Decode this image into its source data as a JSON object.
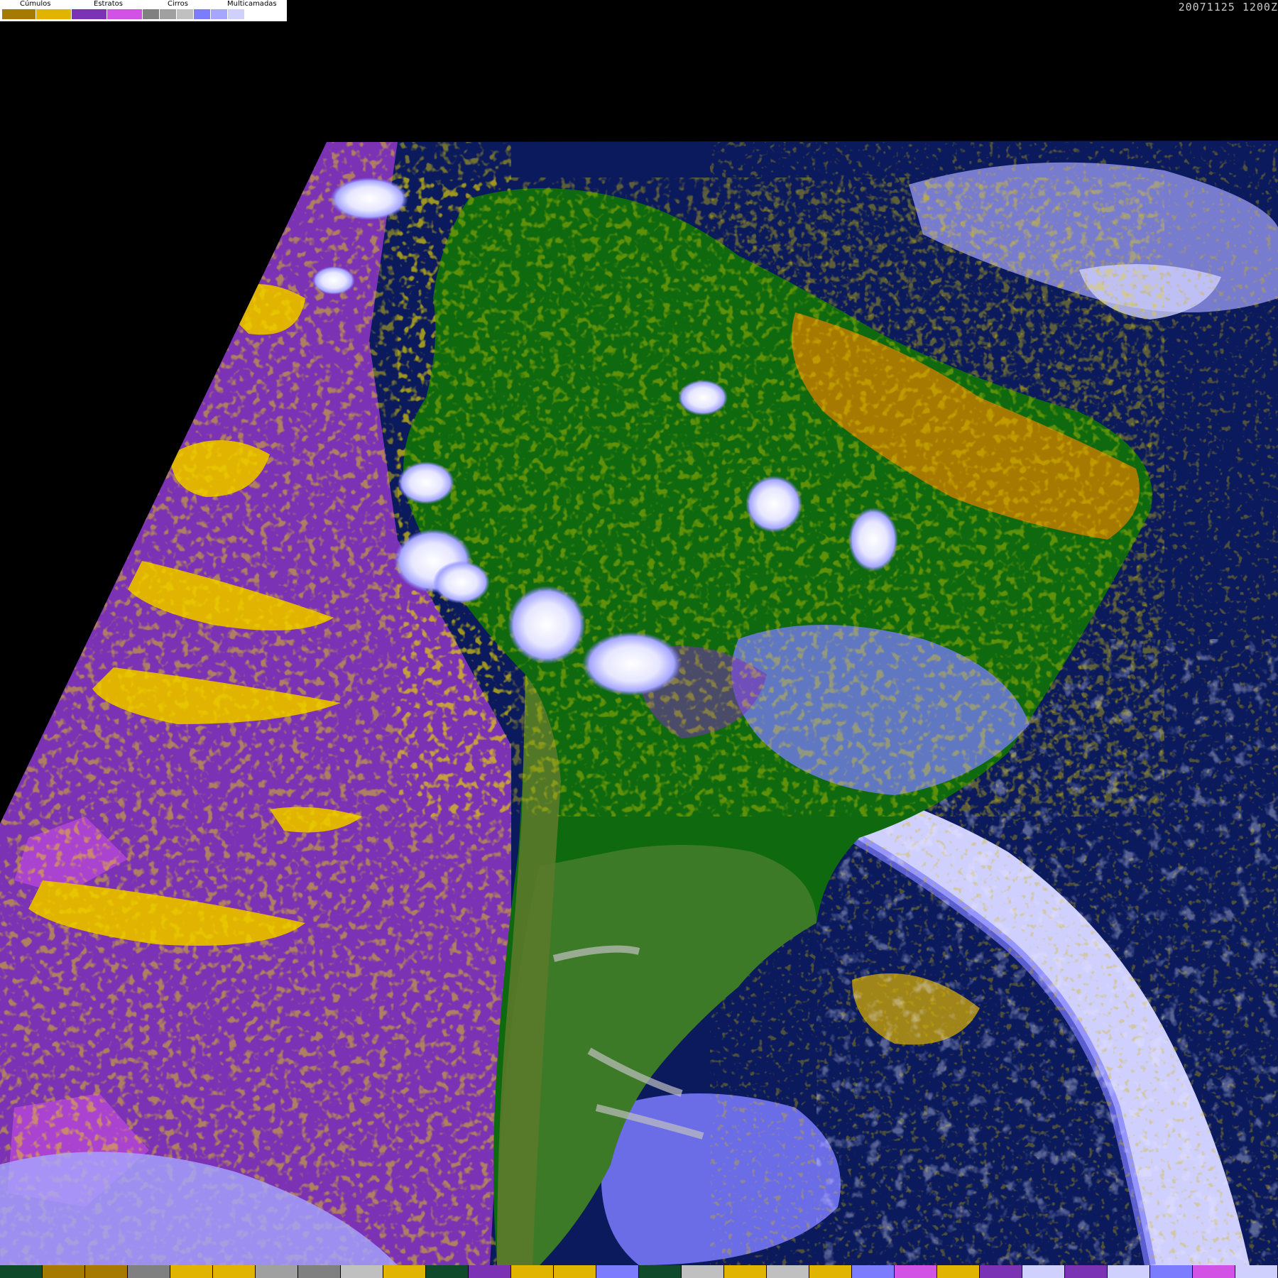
{
  "legend": {
    "groups": [
      {
        "label": "Cúmulos"
      },
      {
        "label": "Estratos"
      },
      {
        "label": "Cirros"
      },
      {
        "label": "Multicamadas"
      }
    ],
    "swatch_colors": [
      "#a67a00",
      "#e0b400",
      "#7b32b4",
      "#d252e6",
      "#808080",
      "#a0a0a0",
      "#c0c0c0",
      "#7c7cff",
      "#a6a6ff",
      "#d0d0ff",
      "#ffffff"
    ]
  },
  "timestamp": "20071125 1200Z",
  "map": {
    "region": "South America",
    "colors": {
      "background": "#000000",
      "ocean": "#0a1a5c",
      "stratus": "#7b32b4",
      "stratus_light": "#d252e6",
      "cumulus_dark": "#a67a00",
      "cumulus_light": "#e0b400",
      "land_forest": "#0f6a0f",
      "land_green": "#3c7a28",
      "cirrus_gray": "#a0a0a0",
      "multilayer_blue": "#7c7cff",
      "multilayer_light": "#d0d0ff",
      "multilayer_white": "#f0f0ff"
    }
  },
  "bottom_bar": {
    "colors": [
      "#0f4a2a",
      "#a67a00",
      "#a67a00",
      "#808080",
      "#e0b400",
      "#e0b400",
      "#a0a0a0",
      "#808080",
      "#c0c0c0",
      "#e0b400",
      "#0f4a2a",
      "#7b32b4",
      "#e0b400",
      "#e0b400",
      "#7c7cff",
      "#0f4a2a",
      "#c0c0c0",
      "#e0b400",
      "#c0c0c0",
      "#e0b400",
      "#7c7cff",
      "#d252e6",
      "#e0b400",
      "#7b32b4",
      "#d0d0ff",
      "#7b32b4",
      "#d0d0ff",
      "#7c7cff",
      "#d252e6",
      "#d0d0ff"
    ]
  }
}
